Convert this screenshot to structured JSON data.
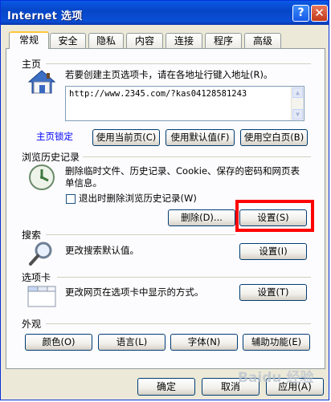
{
  "window": {
    "title": "Internet 选项",
    "help_glyph": "?",
    "close_glyph": "✕"
  },
  "tabs": [
    "常规",
    "安全",
    "隐私",
    "内容",
    "连接",
    "程序",
    "高级"
  ],
  "homepage": {
    "section_label": "主页",
    "description": "若要创建主页选项卡，请在各地址行键入地址(R)。",
    "url": "http://www.2345.com/?kas04128581243",
    "lock_link": "主页锁定",
    "use_current": "使用当前页(C)",
    "use_default": "使用默认值(F)",
    "use_blank": "使用空白页(B)"
  },
  "history": {
    "section_label": "浏览历史记录",
    "description": "删除临时文件、历史记录、Cookie、保存的密码和网页表单信息。",
    "checkbox_label": "退出时删除浏览历史记录(W)",
    "delete_button": "删除(D)...",
    "settings_button": "设置(S)"
  },
  "search": {
    "section_label": "搜索",
    "description": "更改搜索默认值。",
    "settings_button": "设置(I)"
  },
  "tabs_section": {
    "section_label": "选项卡",
    "description": "更改网页在选项卡中显示的方式。",
    "settings_button": "设置(T)"
  },
  "appearance": {
    "section_label": "外观",
    "colors": "颜色(O)",
    "languages": "语言(L)",
    "fonts": "字体(N)",
    "accessibility": "辅助功能(E)"
  },
  "footer": {
    "ok": "确定",
    "cancel": "取消",
    "apply": "应用(A)"
  },
  "watermark": "Baidu 经验",
  "colors": {
    "highlight": "#ff0000",
    "titlebar": "#0a4fd6",
    "link": "#0000ff"
  }
}
